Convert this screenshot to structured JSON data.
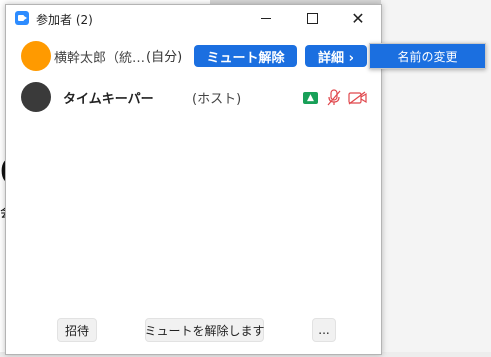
{
  "background": {
    "big_char": "0",
    "small_char": "会"
  },
  "window": {
    "title": "参加者 (2)",
    "controls": {
      "close": "✕"
    }
  },
  "participants": [
    {
      "name": "横幹太郎（統…",
      "tag": "(自分)",
      "unmute_button": "ミュート解除",
      "more_button": "詳細 ›"
    },
    {
      "name": "タイムキーパー",
      "tag": "(ホスト)"
    }
  ],
  "popup_menu": {
    "items": [
      "名前の変更"
    ]
  },
  "footer": {
    "invite": "招待",
    "unmute_all": "ミュートを解除します",
    "more": "..."
  },
  "colors": {
    "accent_blue": "#1b6fe0",
    "avatar_orange": "#ff9a00",
    "share_green": "#18a058",
    "muted_red": "#e0474c"
  }
}
